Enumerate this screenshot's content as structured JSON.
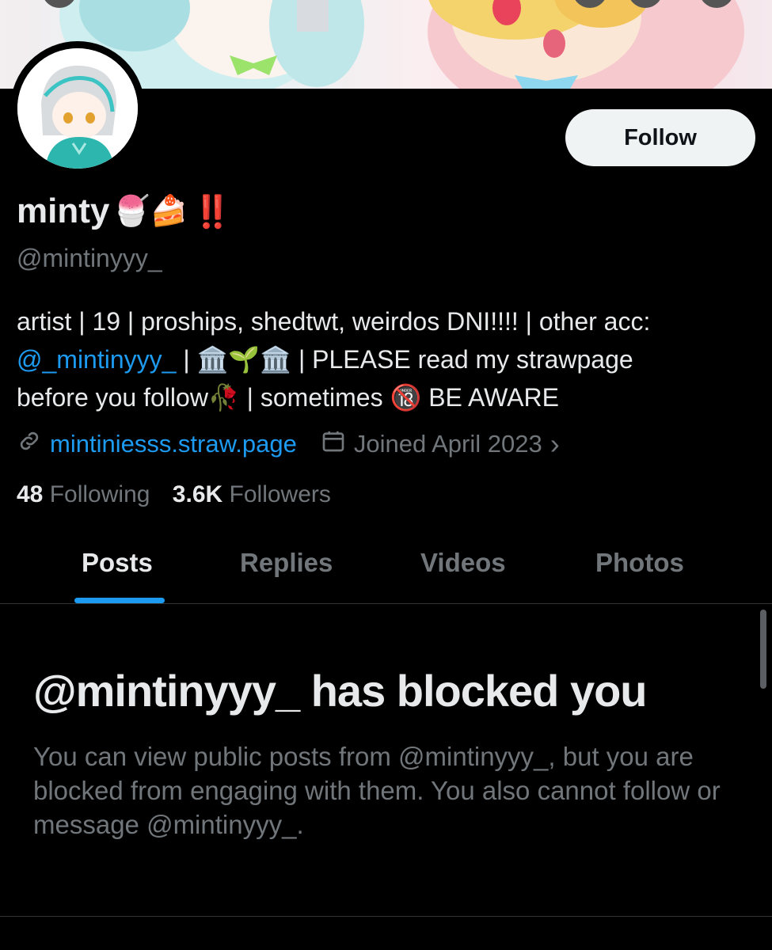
{
  "profile": {
    "display_name": "minty",
    "name_emojis": "🍧🍰",
    "name_bang": "‼️",
    "handle": "@mintinyyy_",
    "follow_label": "Follow"
  },
  "bio": {
    "line1": "artist | 19 | proships, shedtwt, weirdos DNI!!!! | other acc:",
    "mention": "@_mintinyyy_",
    "sep1": " | ",
    "emoji_group": "🏛️🌱🏛️",
    "line2_rest": " | PLEASE read my strawpage",
    "line3_start": "before you follow",
    "wilted_rose": "🥀",
    "line3_mid": " | sometimes ",
    "adult_emoji": "🔞",
    "line3_end": " BE AWARE"
  },
  "meta": {
    "website": "mintiniesss.straw.page",
    "joined": "Joined April 2023",
    "chevron": "›",
    "link_icon": "link-icon",
    "calendar_icon": "calendar-icon"
  },
  "counts": {
    "following_num": "48",
    "following_label": "Following",
    "followers_num": "3.6K",
    "followers_label": "Followers"
  },
  "tabs": [
    {
      "label": "Posts",
      "active": true
    },
    {
      "label": "Replies",
      "active": false
    },
    {
      "label": "Videos",
      "active": false
    },
    {
      "label": "Photos",
      "active": false
    }
  ],
  "blocked": {
    "title": "@mintinyyy_ has blocked you",
    "description": "You can view public posts from @mintinyyy_, but you are blocked from engaging with them. You also cannot follow or message @mintinyyy_."
  },
  "colors": {
    "background": "#000000",
    "accent": "#1d9bf0",
    "text_primary": "#e7e9ea",
    "text_secondary": "#71767b",
    "follow_button_bg": "#eff3f4"
  }
}
